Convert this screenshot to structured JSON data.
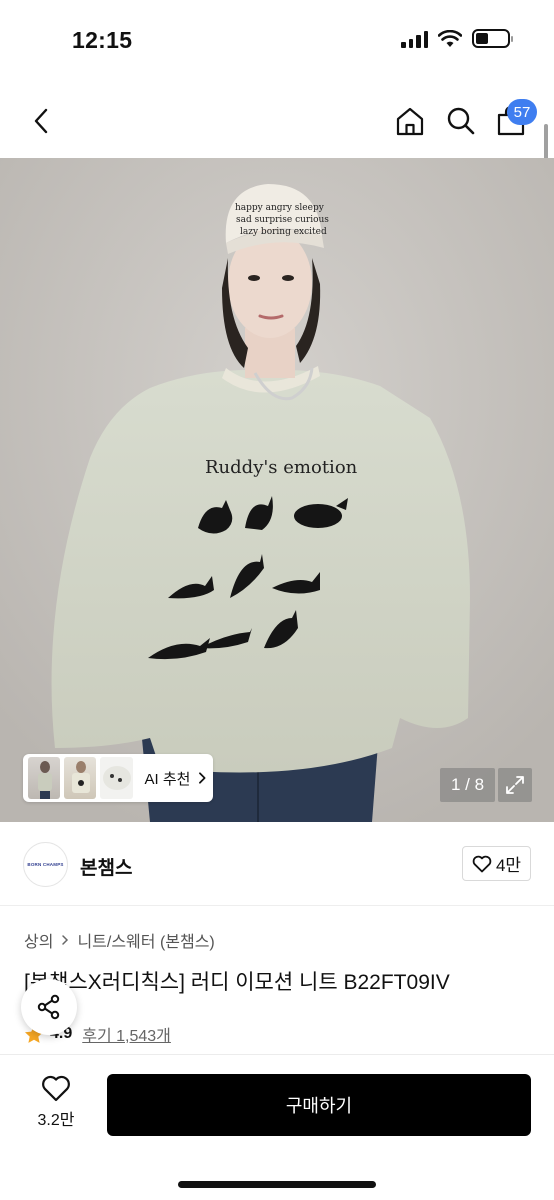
{
  "status_bar": {
    "time": "12:15"
  },
  "nav": {
    "back_icon": "chevron-left-icon",
    "home_icon": "home-icon",
    "search_icon": "search-icon",
    "cart_icon": "shopping-bag-icon",
    "cart_count": "57"
  },
  "hero": {
    "sweater_text": "Ruddy's emotion",
    "cap_words": [
      "happy",
      "angry",
      "sleepy",
      "sad",
      "surprise",
      "curious",
      "lazy",
      "boring",
      "excited"
    ],
    "page_counter": "1 / 8",
    "ai_recommend_label": "AI 추천"
  },
  "brand": {
    "logo_text": "BORN CHAMPS",
    "name": "본챔스",
    "like_count": "4만"
  },
  "product": {
    "breadcrumb": [
      "상의",
      "니트/스웨터 (본챔스)"
    ],
    "title": "[본챔스X러디칙스] 러디 이모션 니트 B22FT09IV",
    "rating": "4.9",
    "review_label": "후기 1,543개"
  },
  "bottom_bar": {
    "wish_count": "3.2만",
    "buy_label": "구매하기"
  },
  "colors": {
    "accent_badge": "#3f7ef0",
    "buy_button": "#000000",
    "star": "#f5a623"
  }
}
